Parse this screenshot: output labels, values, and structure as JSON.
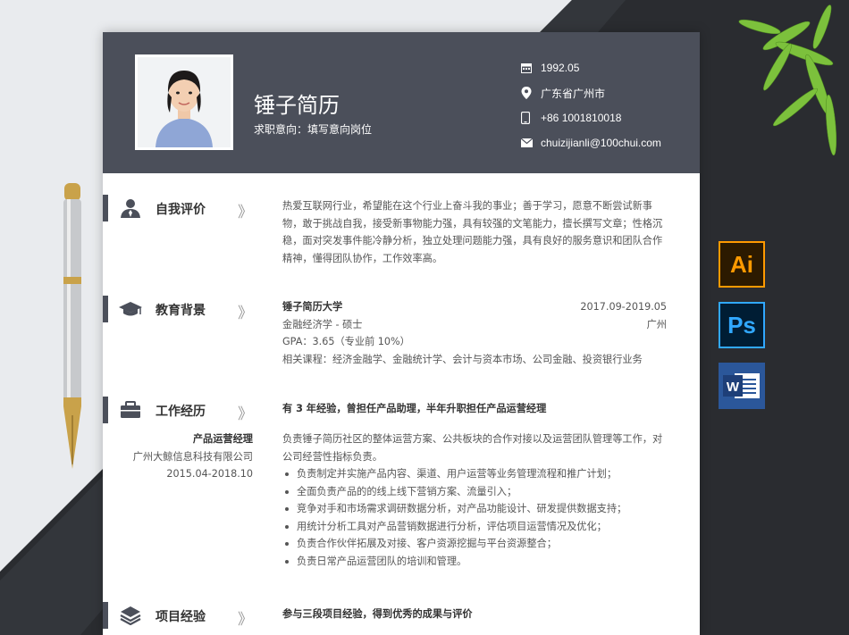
{
  "resume": {
    "name": "锤子简历",
    "intent": "求职意向：填写意向岗位",
    "contact": {
      "birth": "1992.05",
      "location": "广东省广州市",
      "phone": "+86 1001810018",
      "email": "chuizijianli@100chui.com"
    },
    "self_eval": {
      "title": "自我评价",
      "arrow": "》",
      "text": "热爱互联网行业，希望能在这个行业上奋斗我的事业；善于学习，愿意不断尝试新事物，敢于挑战自我，接受新事物能力强，具有较强的文笔能力，擅长撰写文章；性格沉稳，面对突发事件能冷静分析，独立处理问题能力强，具有良好的服务意识和团队合作精神，懂得团队协作，工作效率高。"
    },
    "education": {
      "title": "教育背景",
      "arrow": "》",
      "school": "锤子简历大学",
      "period": "2017.09-2019.05",
      "major": "金融经济学 - 硕士",
      "city": "广州",
      "gpa": "GPA：3.65（专业前 10%）",
      "courses": "相关课程：经济金融学、金融统计学、会计与资本市场、公司金融、投资银行业务"
    },
    "work": {
      "title": "工作经历",
      "arrow": "》",
      "summary": "有 3 年经验，曾担任产品助理，半年升职担任产品运营经理",
      "position": "产品运营经理",
      "company": "广州大鲸信息科技有限公司",
      "period": "2015.04-2018.10",
      "desc": "负责锤子简历社区的整体运营方案、公共板块的合作对接以及运营团队管理等工作，对公司经营性指标负责。",
      "bullets": [
        "负责制定并实施产品内容、渠道、用户运营等业务管理流程和推广计划；",
        "全面负责产品的的线上线下营销方案、流量引入；",
        "竞争对手和市场需求调研数据分析，对产品功能设计、研发提供数据支持；",
        "用统计分析工具对产品营销数据进行分析，评估项目运营情况及优化；",
        "负责合作伙伴拓展及对接、客户资源挖掘与平台资源整合；",
        "负责日常产品运营团队的培训和管理。"
      ]
    },
    "project": {
      "title": "项目经验",
      "arrow": "》",
      "summary": "参与三段项目经验，得到优秀的成果与评价"
    }
  },
  "apps": {
    "ai": "Ai",
    "ps": "Ps",
    "word": "W"
  },
  "colors": {
    "header": "#4b4f5a",
    "background_dark": "#2b2d31",
    "text": "#555555"
  }
}
